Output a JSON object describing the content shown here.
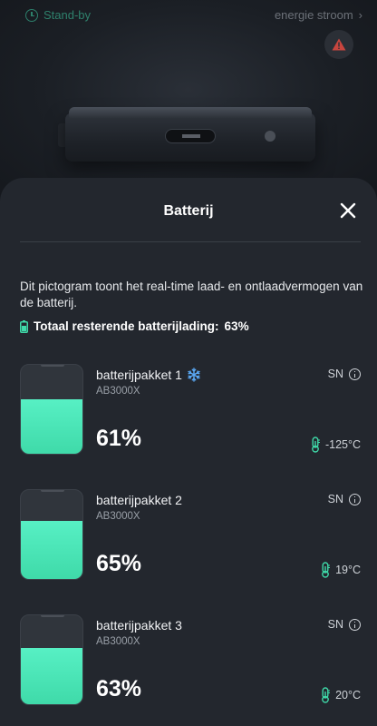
{
  "header": {
    "status_label": "Stand-by",
    "energy_link": "energie stroom",
    "energy_chevron": "›"
  },
  "sheet": {
    "title": "Batterij",
    "description": "Dit pictogram toont het real-time laad- en ontlaadvermogen van de batterij.",
    "total_label": "Totaal resterende batterijlading:",
    "total_value": "63%",
    "total_level": 0.63
  },
  "packs": [
    {
      "name": "batterijpakket 1",
      "model": "AB3000X",
      "percent_label": "61%",
      "level": 0.61,
      "sn": "SN",
      "temperature": "-125°C",
      "snowflake": true
    },
    {
      "name": "batterijpakket 2",
      "model": "AB3000X",
      "percent_label": "65%",
      "level": 0.65,
      "sn": "SN",
      "temperature": "19°C",
      "snowflake": false
    },
    {
      "name": "batterijpakket 3",
      "model": "AB3000X",
      "percent_label": "63%",
      "level": 0.63,
      "sn": "SN",
      "temperature": "20°C",
      "snowflake": false
    }
  ],
  "colors": {
    "accent": "#3fdaa9",
    "sheet_bg": "#23272e",
    "snowflake": "#5aa9f5"
  },
  "icons": {
    "status": "clock-icon",
    "warning": "warning-triangle-icon",
    "close": "close-icon",
    "battery": "battery-icon",
    "snow": "snowflake-icon",
    "info": "info-icon",
    "thermometer": "thermometer-icon"
  }
}
